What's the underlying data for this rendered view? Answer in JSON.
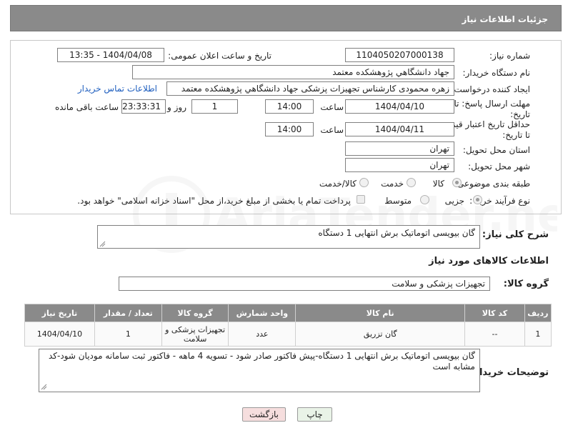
{
  "header": {
    "title": "جزئیات اطلاعات نیاز"
  },
  "form": {
    "need_number_label": "شماره نیاز:",
    "need_number": "1104050207000138",
    "announce_label": "تاریخ و ساعت اعلان عمومی:",
    "announce_value": "1404/04/08 - 13:35",
    "buyer_org_label": "نام دستگاه خریدار:",
    "buyer_org": "جهاد دانشگاهي پژوهشکده معتمد",
    "creator_label": "ایجاد کننده درخواست:",
    "creator": "زهره محمودی کارشناس تجهیزات پزشکی جهاد دانشگاهي پژوهشکده معتمد",
    "contact_link": "اطلاعات تماس خریدار",
    "deadline_label_1": "مهلت ارسال پاسخ: تا",
    "deadline_label_2": "تاریخ:",
    "deadline_date": "1404/04/10",
    "time_label": "ساعت",
    "deadline_time": "14:00",
    "days_value": "1",
    "days_label": "روز و",
    "remaining_value": "23:33:31",
    "remaining_label": "ساعت باقی مانده",
    "price_label_1": "حداقل تاریخ اعتبار قیمت:",
    "price_label_2": "تا تاریخ:",
    "price_date": "1404/04/11",
    "price_time": "14:00",
    "province_label": "استان محل تحویل:",
    "province": "تهران",
    "city_label": "شهر محل تحویل:",
    "city": "تهران",
    "category_label": "طبقه بندی موضوعی:",
    "category_options": [
      "کالا",
      "خدمت",
      "کالا/خدمت"
    ],
    "process_label": "نوع فرآیند خرید :",
    "process_options": [
      "جزیی",
      "متوسط"
    ],
    "payment_note": "پرداخت تمام یا بخشی از مبلغ خرید،از محل \"اسناد خزانه اسلامی\" خواهد بود."
  },
  "description": {
    "label": "شرح کلی نیاز:",
    "value": "گان بیویسی اتوماتیک برش انتهایی 1 دستگاه"
  },
  "goods": {
    "section_title": "اطلاعات کالاهای مورد نیاز",
    "group_label": "گروه کالا:",
    "group_value": "تجهیزات پزشکی و سلامت",
    "columns": [
      "ردیف",
      "کد کالا",
      "نام کالا",
      "واحد شمارش",
      "گروه کالا",
      "تعداد / مقدار",
      "تاریخ نیاز"
    ],
    "rows": [
      [
        "1",
        "--",
        "گان تزریق",
        "عدد",
        "تجهیزات پزشکی و سلامت",
        "1",
        "1404/04/10"
      ]
    ]
  },
  "buyer_notes": {
    "label": "توضیحات خریدار:",
    "value": "گان بیویسی اتوماتیک برش انتهایی 1 دستگاه-پیش فاکتور صادر شود - تسویه 4 ماهه - فاکتور ثبت سامانه مودیان شود-کد مشابه است"
  },
  "buttons": {
    "print": "چاپ",
    "back": "بازگشت"
  },
  "watermark": {
    "text": "AriaTender.net"
  }
}
